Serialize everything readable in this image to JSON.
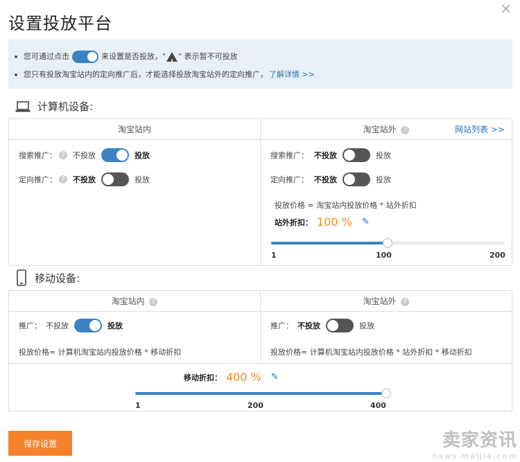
{
  "dialog": {
    "title": "设置投放平台",
    "close": "×"
  },
  "notice": {
    "line1_prefix": "您可通过点击",
    "line1_mid": "来设置是否投放，\"",
    "line1_suffix": "\" 表示暂不可投放",
    "warn_mark": "!",
    "line2_text": "您只有投放淘宝站内的定向推广后，才能选择投放淘宝站外的定向推广，",
    "line2_link": "了解详情 >>"
  },
  "computer": {
    "heading": "计算机设备:",
    "inside": {
      "header": "淘宝站内",
      "search_label": "搜索推广：",
      "search_off": "不投放",
      "search_on": "投放",
      "search_state": true,
      "target_label": "定向推广：",
      "target_off": "不投放",
      "target_on": "投放",
      "target_state": false
    },
    "outside": {
      "header": "淘宝站外",
      "site_list_link": "网站列表 >>",
      "search_label": "搜索推广：",
      "search_off": "不投放",
      "search_on": "投放",
      "search_state": false,
      "target_label": "定向推广：",
      "target_off": "不投放",
      "target_on": "投放",
      "target_state": false,
      "price_formula": "投放价格 = 淘宝站内投放价格 * 站外折扣",
      "discount_label": "站外折扣：",
      "discount_value": "100 %",
      "slider": {
        "min": 1,
        "max": 200,
        "value": 100
      },
      "ticks": [
        "1",
        "100",
        "200"
      ]
    }
  },
  "mobile": {
    "heading": "移动设备:",
    "inside": {
      "header": "淘宝站内",
      "promo_label": "推广：",
      "promo_off": "不投放",
      "promo_on": "投放",
      "promo_state": true,
      "price_formula": "投放价格= 计算机淘宝站内投放价格 * 移动折扣"
    },
    "outside": {
      "header": "淘宝站外",
      "promo_label": "推广：",
      "promo_off": "不投放",
      "promo_on": "投放",
      "promo_state": false,
      "price_formula": "投放价格= 计算机淘宝站内投放价格 * 站外折扣 * 移动折扣"
    },
    "discount_label": "移动折扣：",
    "discount_value": "400 %",
    "slider": {
      "min": 1,
      "max": 400,
      "value": 400
    },
    "ticks": [
      "1",
      "200",
      "400"
    ]
  },
  "footer": {
    "save_label": "保存设置"
  },
  "watermark": {
    "big": "卖家资讯",
    "small": "news.maijia.com"
  },
  "colors": {
    "accent": "#3b82c4",
    "orange": "#f5822a",
    "number": "#f08c1a"
  },
  "icons": [
    "laptop-icon",
    "phone-icon",
    "help-icon",
    "pencil-icon",
    "warning-icon",
    "close-icon"
  ]
}
